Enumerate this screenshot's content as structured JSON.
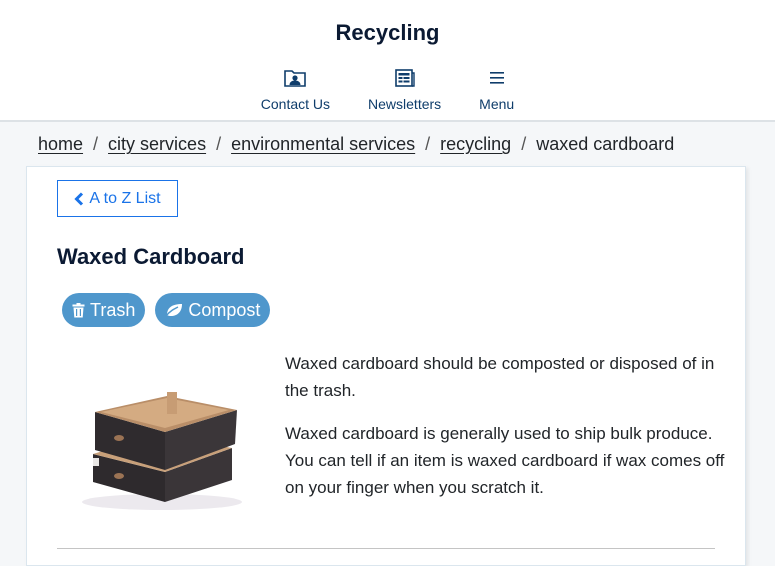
{
  "header": {
    "title": "Recycling",
    "nav": [
      {
        "label": "Contact Us",
        "icon": "contact-card-icon"
      },
      {
        "label": "Newsletters",
        "icon": "newspaper-icon"
      },
      {
        "label": "Menu",
        "icon": "hamburger-menu-icon"
      }
    ]
  },
  "breadcrumb": {
    "items": [
      {
        "label": "home",
        "link": true
      },
      {
        "label": "city services",
        "link": true
      },
      {
        "label": "environmental services",
        "link": true
      },
      {
        "label": "recycling",
        "link": true
      },
      {
        "label": "waxed cardboard",
        "link": false
      }
    ],
    "separator": "/"
  },
  "content": {
    "back_button": "A to Z List",
    "title": "Waxed Cardboard",
    "tags": [
      {
        "label": "Trash",
        "icon": "trash-icon"
      },
      {
        "label": "Compost",
        "icon": "leaf-icon"
      }
    ],
    "image_alt": "Stacked black waxed cardboard produce boxes",
    "paragraphs": [
      "Waxed cardboard should be composted or disposed of in the trash.",
      "Waxed cardboard is generally used to ship bulk produce. You can tell if an item is waxed cardboard if wax comes off on your finger when you scratch it."
    ]
  },
  "colors": {
    "accent": "#1a73e8",
    "tag": "#4f97cc",
    "nav_text": "#0f3d6b",
    "title": "#0b1a33"
  }
}
